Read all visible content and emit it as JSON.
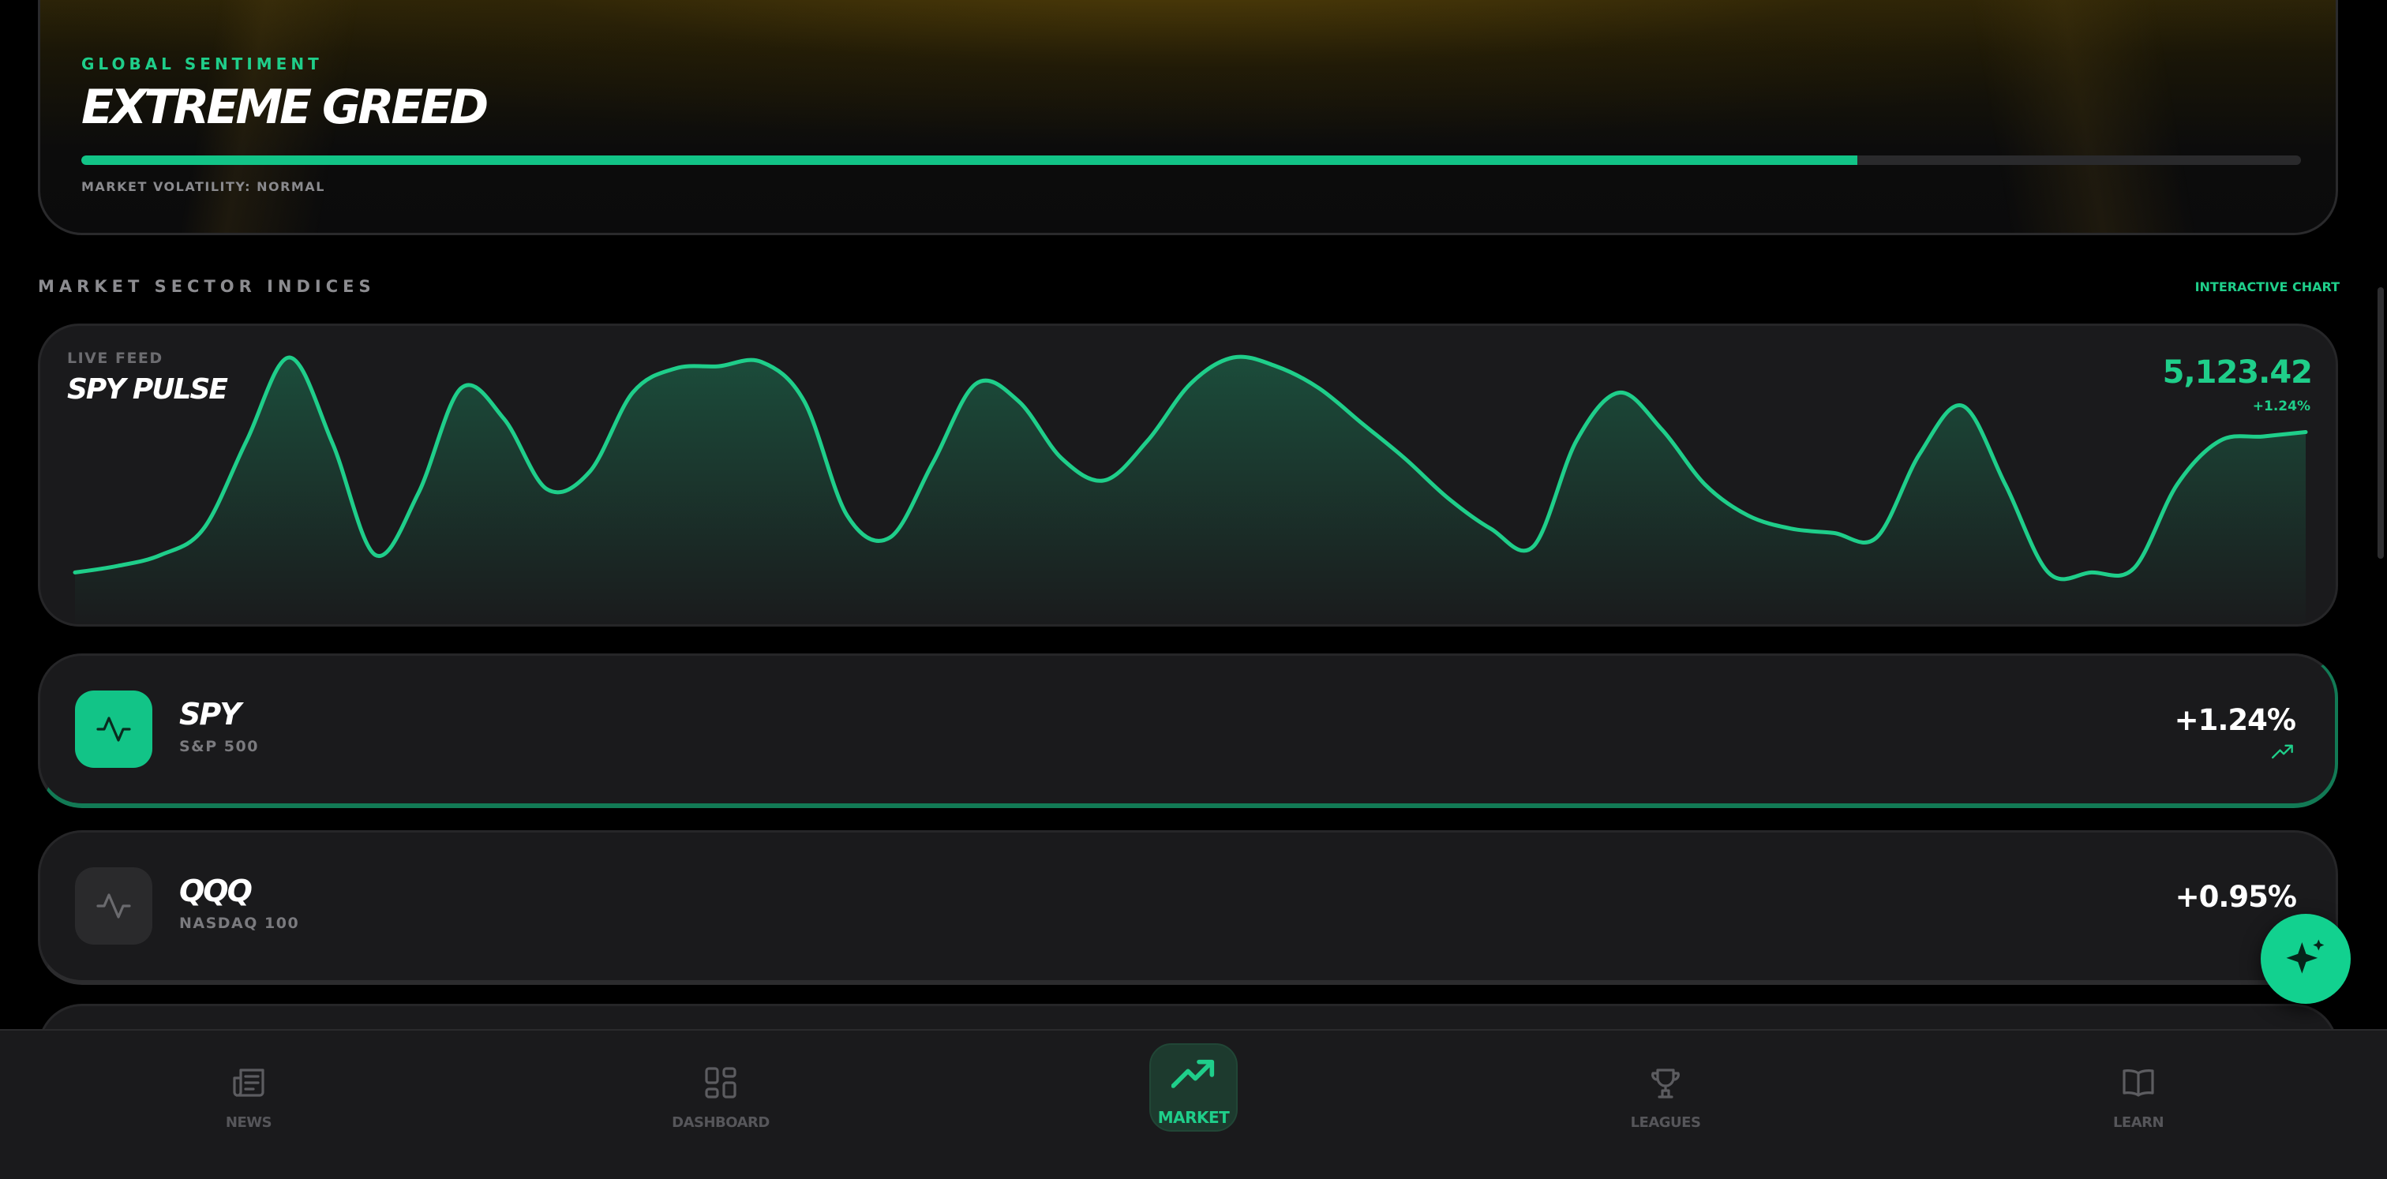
{
  "hero": {
    "eyebrow": "GLOBAL SENTIMENT",
    "title": "EXTREME GREED",
    "progress": 0.8,
    "volatility": "MARKET VOLATILITY: NORMAL"
  },
  "section": {
    "title": "MARKET SECTOR INDICES",
    "link": "INTERACTIVE CHART"
  },
  "pulse": {
    "eyebrow": "LIVE FEED",
    "title": "SPY PULSE",
    "price": "5,123.42",
    "change": "+1.24%"
  },
  "chart_data": {
    "type": "area",
    "values": [
      2,
      5,
      10,
      22,
      62,
      100,
      61,
      10,
      38,
      86,
      72,
      40,
      48,
      84,
      95,
      96,
      98,
      80,
      28,
      18,
      52,
      88,
      80,
      54,
      44,
      62,
      88,
      100,
      96,
      86,
      70,
      54,
      36,
      22,
      14,
      62,
      84,
      67,
      42,
      28,
      22,
      20,
      18,
      56,
      78,
      42,
      2,
      2,
      4,
      42,
      62,
      64,
      66
    ],
    "ylim": [
      0,
      100
    ],
    "grid": false,
    "line_color": "#1fce8a"
  },
  "indices": [
    {
      "symbol": "SPY",
      "name": "S&P 500",
      "change": "+1.24%",
      "active": true
    },
    {
      "symbol": "QQQ",
      "name": "NASDAQ 100",
      "change": "+0.95%",
      "active": false
    }
  ],
  "fab": {
    "icon": "sparkle-icon"
  },
  "nav": {
    "items": [
      {
        "label": "NEWS",
        "icon": "newspaper-icon"
      },
      {
        "label": "DASHBOARD",
        "icon": "grid-icon"
      },
      {
        "label": "MARKET",
        "icon": "trending-up-icon",
        "active": true
      },
      {
        "label": "LEAGUES",
        "icon": "trophy-icon"
      },
      {
        "label": "LEARN",
        "icon": "book-icon"
      }
    ]
  },
  "colors": {
    "accent": "#1fce8a",
    "card": "#1a1a1c",
    "background": "#000000"
  }
}
